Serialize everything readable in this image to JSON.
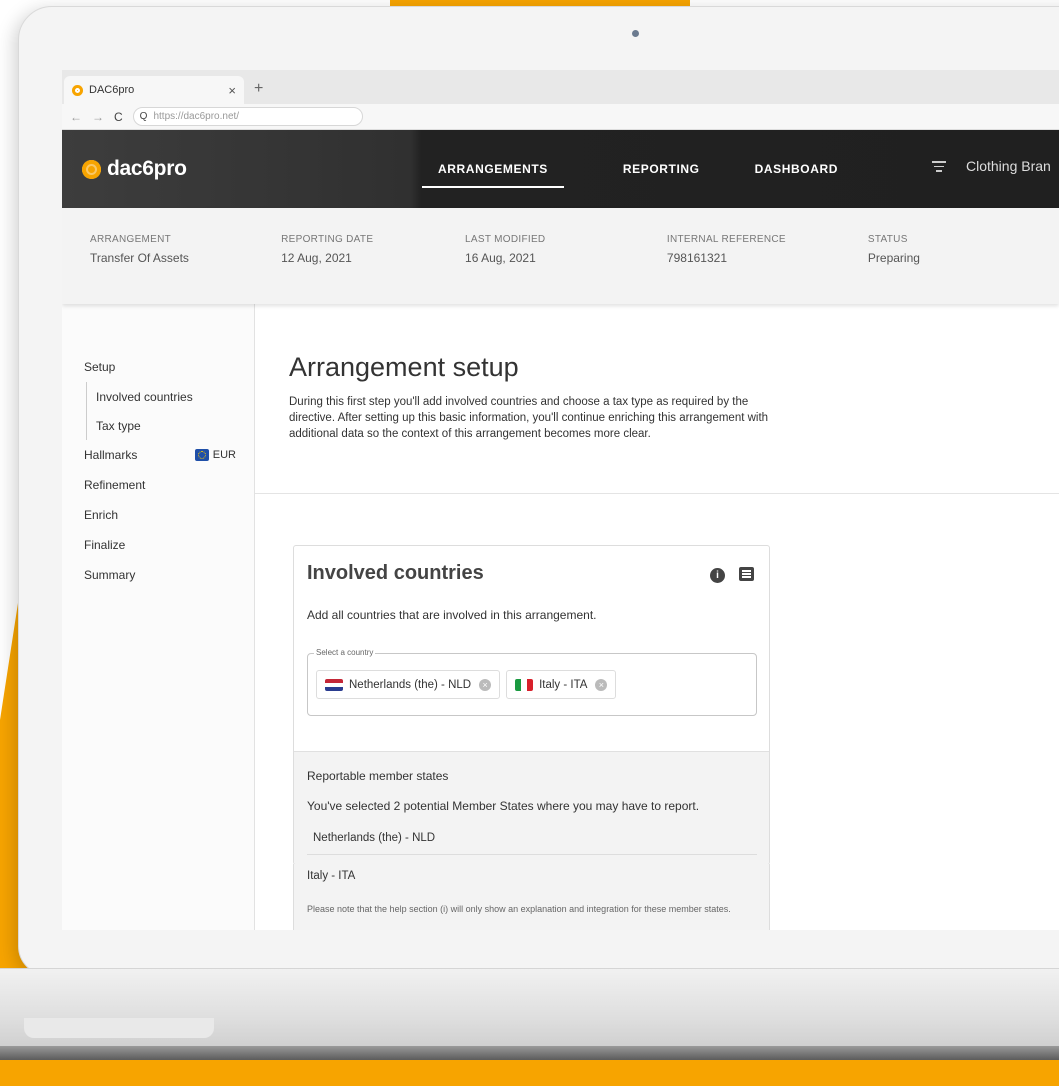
{
  "browser": {
    "tab_title": "DAC6pro",
    "tab_close": "×",
    "new_tab": "+",
    "url": "https://dac6pro.net/"
  },
  "app": {
    "logo_text": "dac6pro",
    "nav": [
      {
        "label": "ARRANGEMENTS",
        "active": true
      },
      {
        "label": "REPORTING",
        "active": false
      },
      {
        "label": "DASHBOARD",
        "active": false
      }
    ],
    "org_name": "Clothing Bran"
  },
  "info_bar": [
    {
      "label": "ARRANGEMENT",
      "value": "Transfer Of Assets"
    },
    {
      "label": "REPORTING DATE",
      "value": "12 Aug, 2021"
    },
    {
      "label": "LAST MODIFIED",
      "value": "16 Aug, 2021"
    },
    {
      "label": "INTERNAL REFERENCE",
      "value": "798161321"
    },
    {
      "label": "STATUS",
      "value": "Preparing"
    }
  ],
  "sidebar": {
    "setup": "Setup",
    "sub_items": [
      "Involved countries",
      "Tax type"
    ],
    "hallmarks": "Hallmarks",
    "currency_badge": "EUR",
    "items": [
      "Refinement",
      "Enrich",
      "Finalize",
      "Summary"
    ]
  },
  "main": {
    "title": "Arrangement setup",
    "intro": "During this first step you'll add involved countries and choose a tax type as required by the directive. After setting up this basic information, you'll continue enriching this arrangement with additional data so the context of this arrangement becomes more clear."
  },
  "card": {
    "title": "Involved countries",
    "description": "Add all countries that are involved in this arrangement.",
    "select_label": "Select a country",
    "chips": [
      "Netherlands (the) - NLD",
      "Italy - ITA"
    ],
    "member_title": "Reportable member states",
    "member_desc": "You've selected 2 potential Member States where you may have to report.",
    "members": [
      "Netherlands (the) - NLD",
      "Italy - ITA"
    ],
    "note": "Please note that the help section (i) will only show an explanation and integration for these member states."
  },
  "colors": {
    "brand_orange": "#f7a400",
    "nav_dark": "#202020"
  }
}
